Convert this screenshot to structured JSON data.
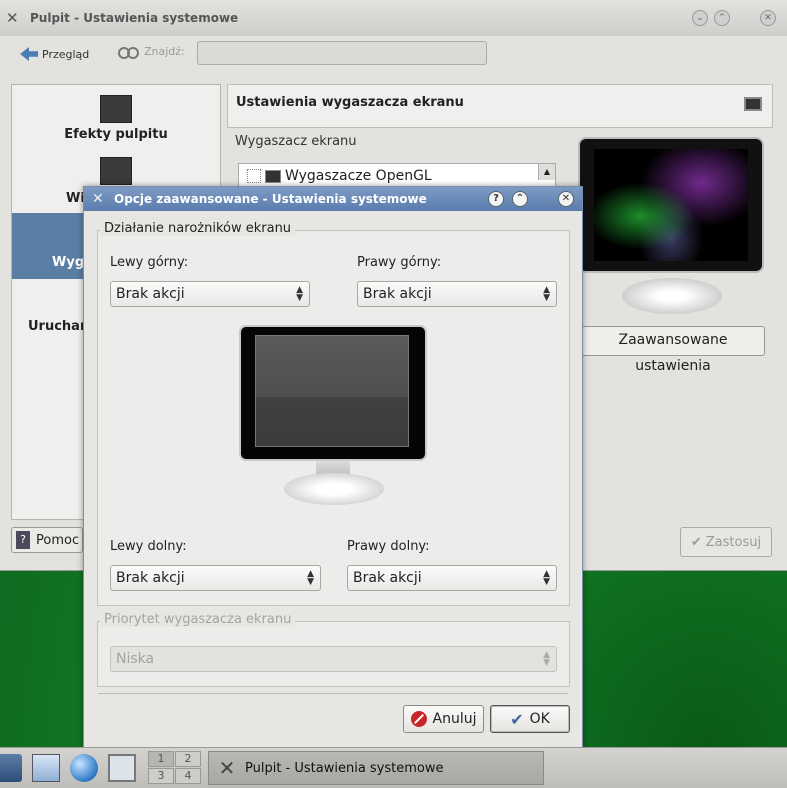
{
  "main_window": {
    "title": "Pulpit - Ustawienia systemowe",
    "toolbar": {
      "back_label": "Przegląd",
      "find_label": "Znajdź:",
      "find_value": ""
    },
    "sidebar": [
      {
        "label": "Efekty pulpitu"
      },
      {
        "label": "Wi"
      },
      {
        "label": "Wyg",
        "selected": true
      },
      {
        "label": "Uruchar"
      }
    ],
    "help_label": "Pomoc",
    "apply_label": "Zastosuj",
    "header_title": "Ustawienia wygaszacza ekranu",
    "screensaver_group_label": "Wygaszacz ekranu",
    "screensaver_tree_item": "Wygaszacze OpenGL",
    "advanced_button": "Zaawansowane ustawienia"
  },
  "dialog": {
    "title": "Opcje zaawansowane - Ustawienia systemowe",
    "corners_group": "Działanie narożników ekranu",
    "top_left_label": "Lewy górny:",
    "top_left_value": "Brak akcji",
    "top_right_label": "Prawy górny:",
    "top_right_value": "Brak akcji",
    "bottom_left_label": "Lewy dolny:",
    "bottom_left_value": "Brak akcji",
    "bottom_right_label": "Prawy dolny:",
    "bottom_right_value": "Brak akcji",
    "priority_group": "Priorytet wygaszacza ekranu",
    "priority_value": "Niska",
    "cancel_label": "Anuluj",
    "ok_label": "OK"
  },
  "taskbar": {
    "pager": [
      "1",
      "2",
      "3",
      "4"
    ],
    "task_label": "Pulpit - Ustawienia systemowe"
  },
  "colors": {
    "dialog_titlebar": "#5a7dae",
    "selection": "#5b7ea4",
    "desktop": "#138a2a"
  },
  "icons": [
    "tools-icon",
    "back-arrow-icon",
    "binoculars-icon",
    "monitor-icon",
    "help-icon",
    "check-icon",
    "cancel-icon"
  ]
}
